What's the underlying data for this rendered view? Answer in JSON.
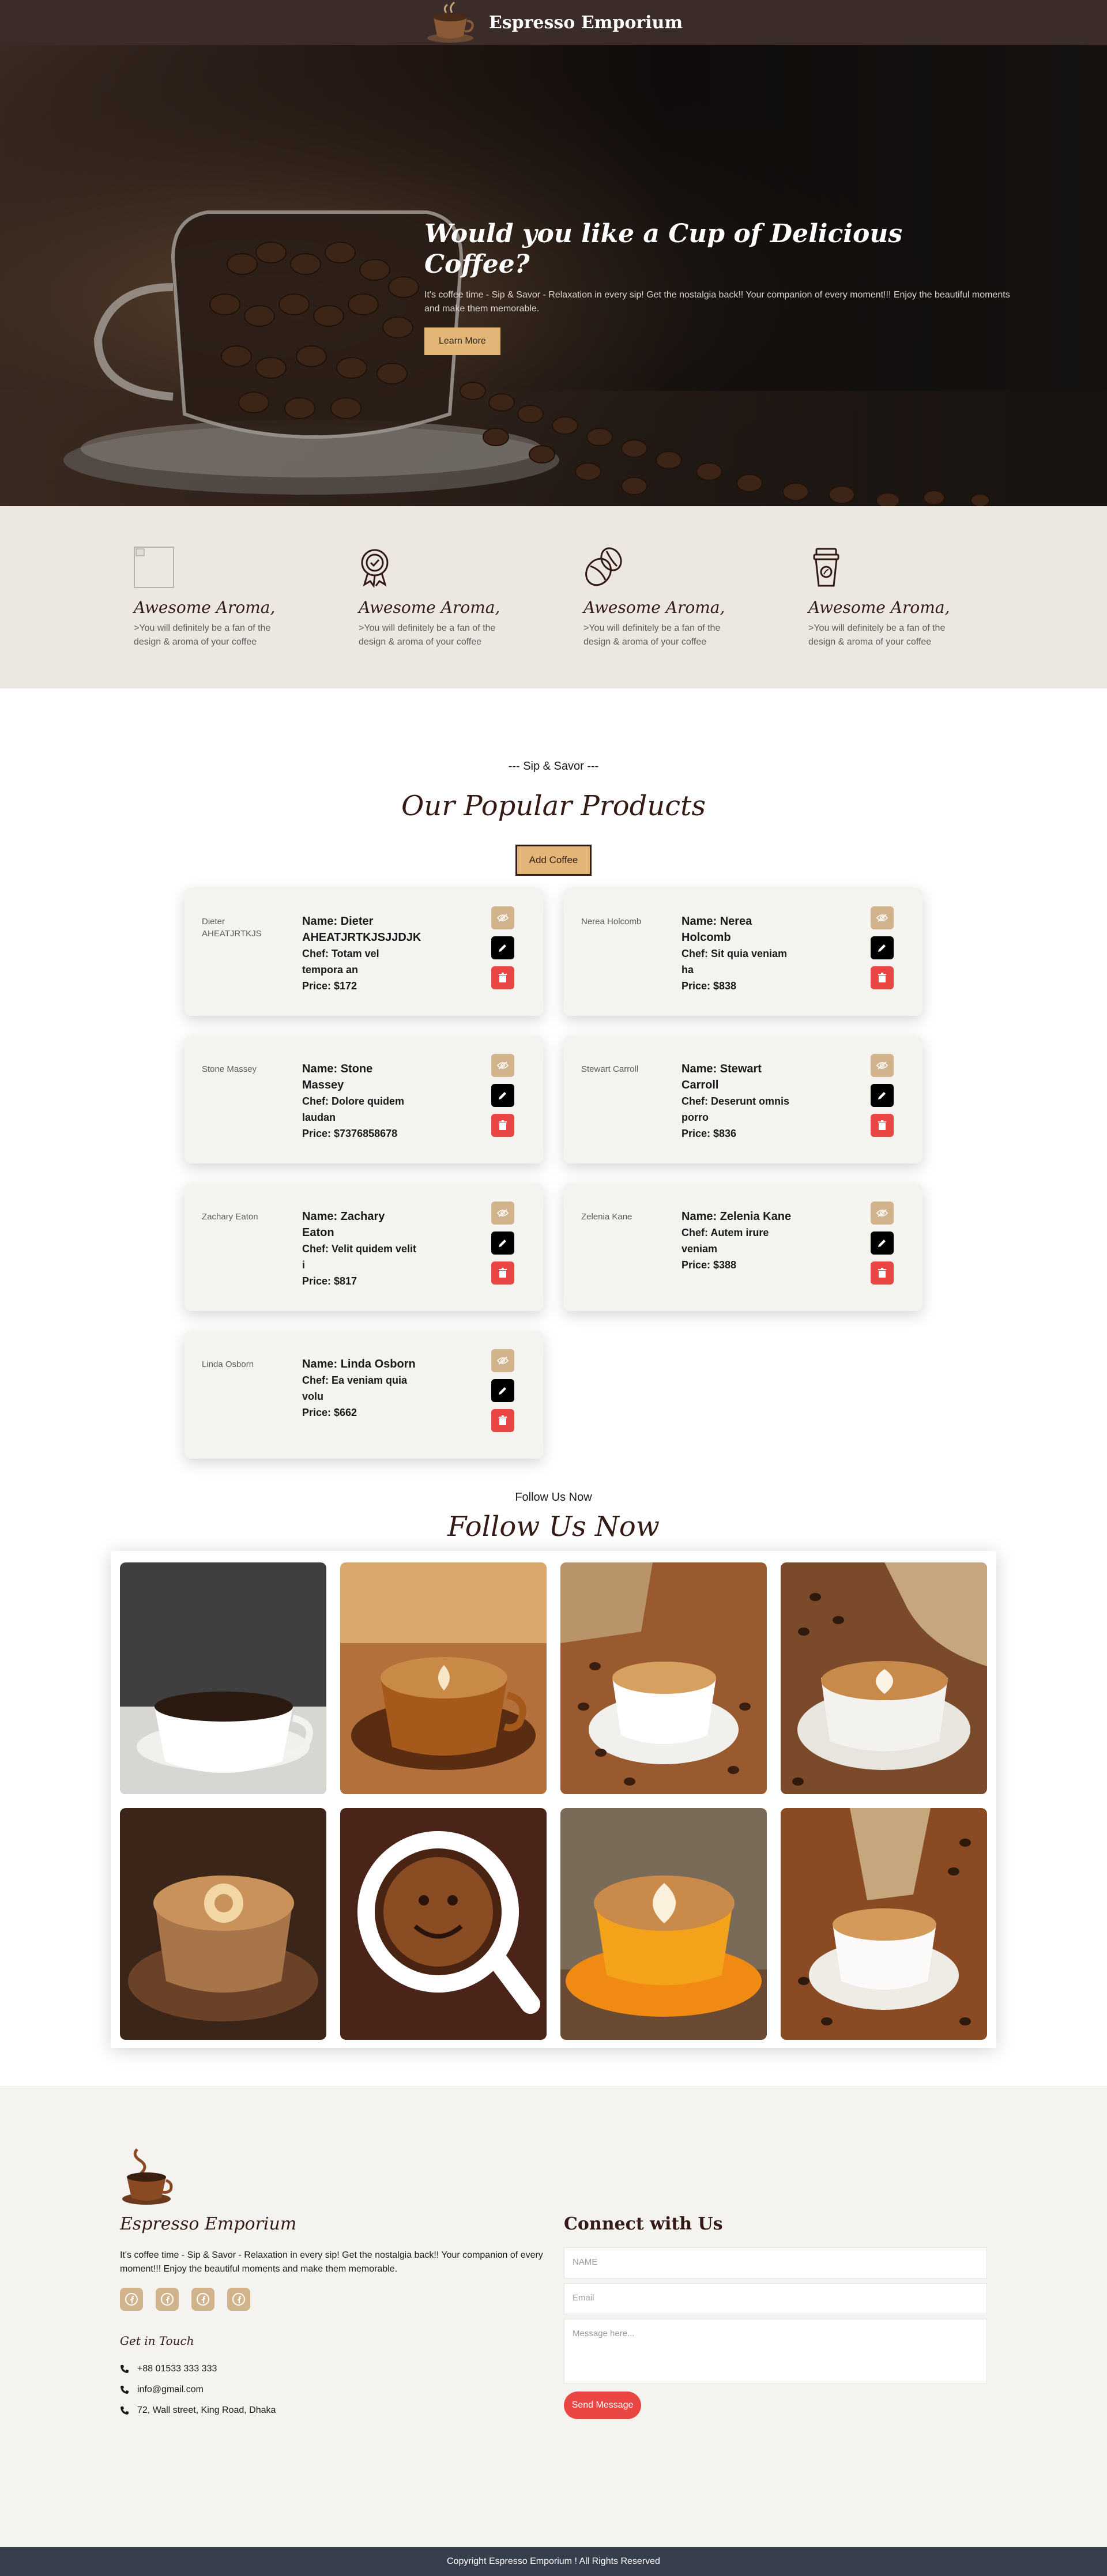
{
  "header": {
    "brand": "Espresso Emporium"
  },
  "hero": {
    "title": "Would you like a Cup of Delicious Coffee?",
    "text": "It's coffee time - Sip & Savor - Relaxation in every sip! Get the nostalgia back!! Your companion of every moment!!! Enjoy the beautiful moments and make them memorable.",
    "button": "Learn More"
  },
  "features": [
    {
      "icon": "broken-image-icon",
      "title": "Awesome Aroma,",
      "text": ">You will definitely be a fan of the design & aroma of your coffee"
    },
    {
      "icon": "badge-icon",
      "title": "Awesome Aroma,",
      "text": ">You will definitely be a fan of the design & aroma of your coffee"
    },
    {
      "icon": "coffee-bean-icon",
      "title": "Awesome Aroma,",
      "text": ">You will definitely be a fan of the design & aroma of your coffee"
    },
    {
      "icon": "coffee-cup-icon",
      "title": "Awesome Aroma,",
      "text": ">You will definitely be a fan of the design & aroma of your coffee"
    }
  ],
  "products": {
    "subtitle": "--- Sip & Savor ---",
    "title": "Our Popular Products",
    "add_button": "Add Coffee",
    "items": [
      {
        "alt": "Dieter AHEATJRTKJS",
        "name": "Name: Dieter AHEATJRTKJSJJDJK",
        "chef": "Chef: Totam vel tempora an",
        "price": "Price: $172"
      },
      {
        "alt": "Nerea Holcomb",
        "name": "Name: Nerea Holcomb",
        "chef": "Chef: Sit quia veniam ha",
        "price": "Price: $838"
      },
      {
        "alt": "Stone Massey",
        "name": "Name: Stone Massey",
        "chef": "Chef: Dolore quidem laudan",
        "price": "Price: $7376858678"
      },
      {
        "alt": "Stewart Carroll",
        "name": "Name: Stewart Carroll",
        "chef": "Chef: Deserunt omnis porro",
        "price": "Price: $836"
      },
      {
        "alt": "Zachary Eaton",
        "name": "Name: Zachary Eaton",
        "chef": "Chef: Velit quidem velit i",
        "price": "Price: $817"
      },
      {
        "alt": "Zelenia Kane",
        "name": "Name: Zelenia Kane",
        "chef": "Chef: Autem irure veniam",
        "price": "Price: $388"
      },
      {
        "alt": "Linda Osborn",
        "name": "Name: Linda Osborn",
        "chef": "Chef: Ea veniam quia volu",
        "price": "Price: $662"
      }
    ]
  },
  "follow": {
    "subtitle": "Follow Us Now",
    "title": "Follow Us Now"
  },
  "footer": {
    "brand": "Espresso Emporium",
    "description": "It's coffee time - Sip & Savor - Relaxation in every sip! Get the nostalgia back!! Your companion of every moment!!! Enjoy the beautiful moments and make them memorable.",
    "socials": [
      "facebook-icon",
      "twitter-icon",
      "instagram-icon",
      "linkedin-icon"
    ],
    "get_in_touch": "Get in Touch",
    "phone": "+88 01533 333 333",
    "email": "info@gmail.com",
    "address": "72, Wall street, King Road, Dhaka",
    "connect_title": "Connect with Us",
    "name_placeholder": "NAME",
    "email_placeholder": "Email",
    "message_placeholder": "Message here...",
    "send_button": "Send Message",
    "copyright": "Copyright Espresso Emporium ! All Rights Reserved"
  },
  "colors": {
    "accent": "#e3b577",
    "dark": "#3b2c2a",
    "danger": "#ea4744",
    "tan": "#d2b48c"
  }
}
